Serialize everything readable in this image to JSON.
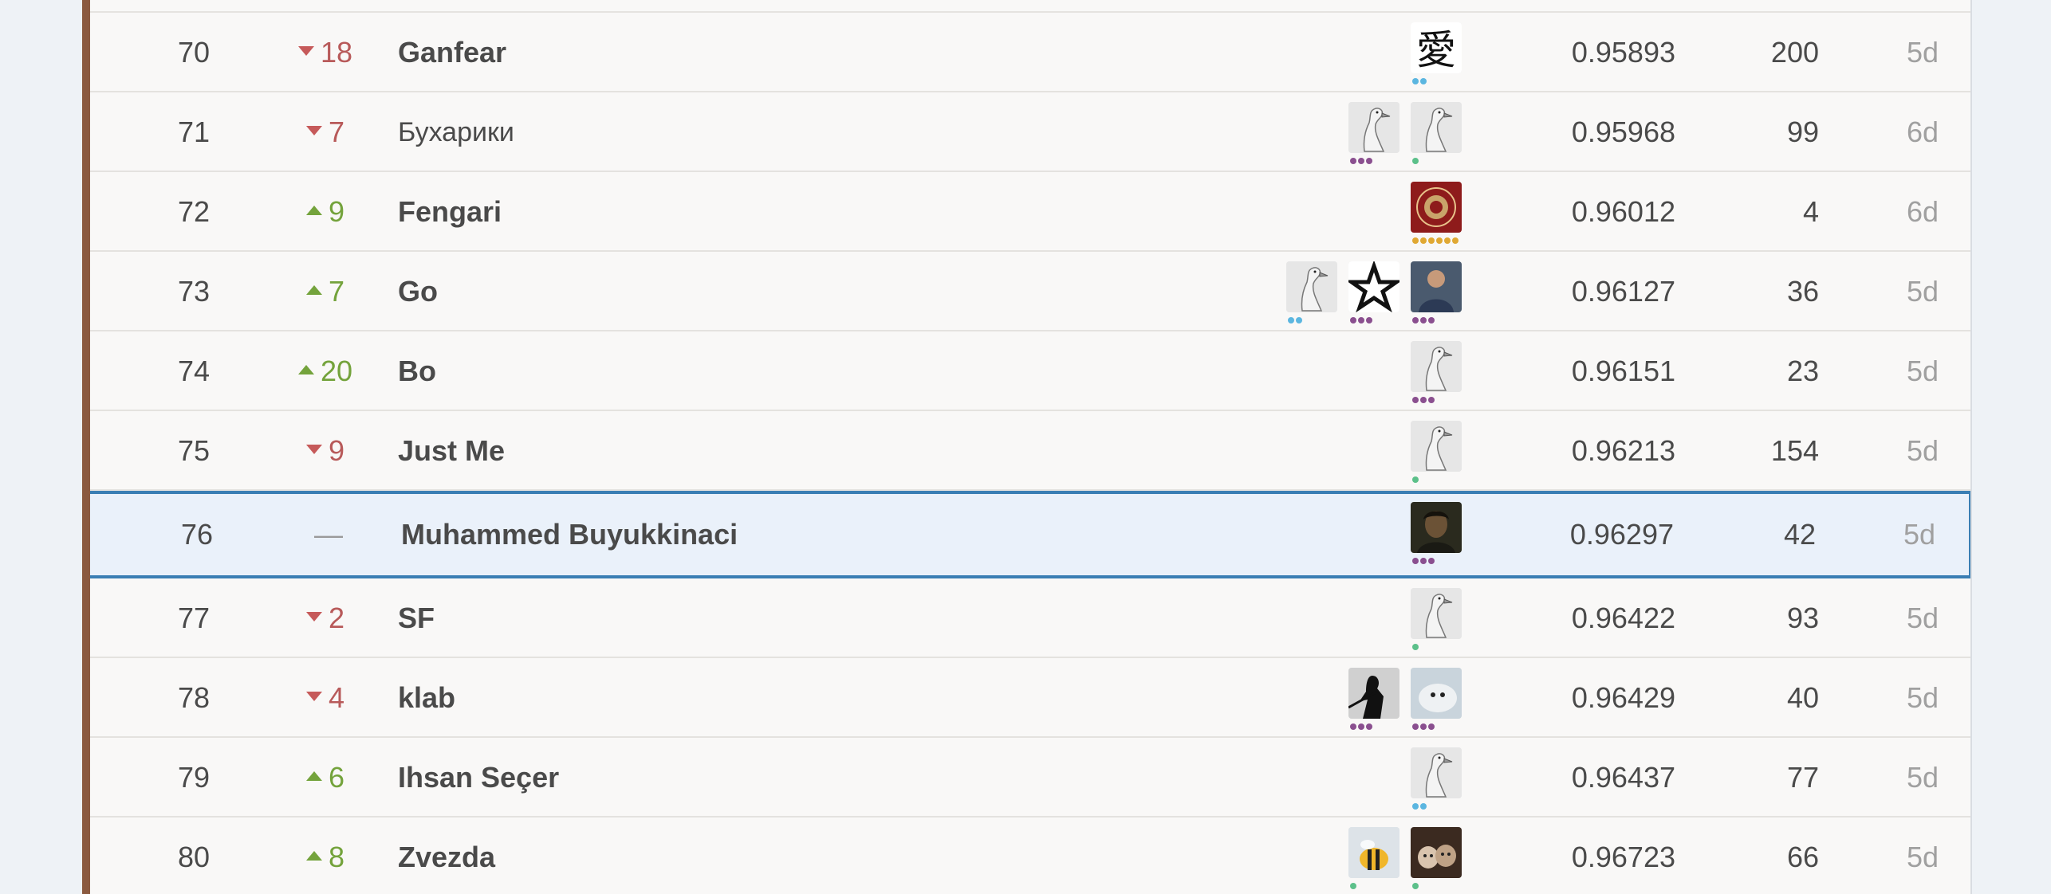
{
  "colors": {
    "up": "#74a33c",
    "down": "#b85a5a",
    "highlight_border": "#3a7eb4",
    "highlight_bg": "#eaf1fa",
    "tier_blue": "#5bb6e0",
    "tier_green": "#5cc08a",
    "tier_purple": "#8a4f8f",
    "tier_gold": "#e0a833"
  },
  "rows": [
    {
      "rank": "70",
      "dir": "down",
      "change": "18",
      "team": "Ganfear",
      "score": "0.95893",
      "entries": "200",
      "last": "5d",
      "avatars": [
        {
          "icon": "kanji-icon",
          "tier": "blue",
          "dots": 2
        }
      ]
    },
    {
      "rank": "71",
      "dir": "down",
      "change": "7",
      "team": "Бухарики",
      "light": true,
      "score": "0.95968",
      "entries": "99",
      "last": "6d",
      "avatars": [
        {
          "icon": "goose-icon",
          "tier": "green",
          "dots": 1
        },
        {
          "icon": "goose-icon",
          "tier": "purple",
          "dots": 3
        }
      ]
    },
    {
      "rank": "72",
      "dir": "up",
      "change": "9",
      "team": "Fengari",
      "score": "0.96012",
      "entries": "4",
      "last": "6d",
      "avatars": [
        {
          "icon": "seal-icon",
          "tier": "gold",
          "dots": 6
        }
      ]
    },
    {
      "rank": "73",
      "dir": "up",
      "change": "7",
      "team": "Go",
      "score": "0.96127",
      "entries": "36",
      "last": "5d",
      "avatars": [
        {
          "icon": "person-photo-icon",
          "tier": "purple",
          "dots": 3
        },
        {
          "icon": "star-logo-icon",
          "tier": "purple",
          "dots": 3
        },
        {
          "icon": "goose-icon",
          "tier": "blue",
          "dots": 2
        }
      ]
    },
    {
      "rank": "74",
      "dir": "up",
      "change": "20",
      "team": "Bo",
      "score": "0.96151",
      "entries": "23",
      "last": "5d",
      "avatars": [
        {
          "icon": "goose-icon",
          "tier": "purple",
          "dots": 3
        }
      ]
    },
    {
      "rank": "75",
      "dir": "down",
      "change": "9",
      "team": "Just Me",
      "score": "0.96213",
      "entries": "154",
      "last": "5d",
      "avatars": [
        {
          "icon": "goose-icon",
          "tier": "green",
          "dots": 1
        }
      ]
    },
    {
      "rank": "76",
      "dir": "none",
      "change": "—",
      "team": "Muhammed Buyukkinaci",
      "score": "0.96297",
      "entries": "42",
      "last": "5d",
      "highlight": true,
      "avatars": [
        {
          "icon": "portrait-photo-icon",
          "tier": "purple",
          "dots": 3
        }
      ]
    },
    {
      "rank": "77",
      "dir": "down",
      "change": "2",
      "team": "SF",
      "score": "0.96422",
      "entries": "93",
      "last": "5d",
      "avatars": [
        {
          "icon": "goose-icon",
          "tier": "green",
          "dots": 1
        }
      ]
    },
    {
      "rank": "78",
      "dir": "down",
      "change": "4",
      "team": "klab",
      "score": "0.96429",
      "entries": "40",
      "last": "5d",
      "avatars": [
        {
          "icon": "seal-animal-icon",
          "tier": "purple",
          "dots": 3
        },
        {
          "icon": "silhouette-icon",
          "tier": "purple",
          "dots": 3
        }
      ]
    },
    {
      "rank": "79",
      "dir": "up",
      "change": "6",
      "team": "Ihsan Seçer",
      "score": "0.96437",
      "entries": "77",
      "last": "5d",
      "avatars": [
        {
          "icon": "goose-icon",
          "tier": "blue",
          "dots": 2
        }
      ]
    },
    {
      "rank": "80",
      "dir": "up",
      "change": "8",
      "team": "Zvezda",
      "score": "0.96723",
      "entries": "66",
      "last": "5d",
      "avatars": [
        {
          "icon": "cats-photo-icon",
          "tier": "green",
          "dots": 1
        },
        {
          "icon": "bee-icon",
          "tier": "green",
          "dots": 1
        }
      ]
    }
  ]
}
